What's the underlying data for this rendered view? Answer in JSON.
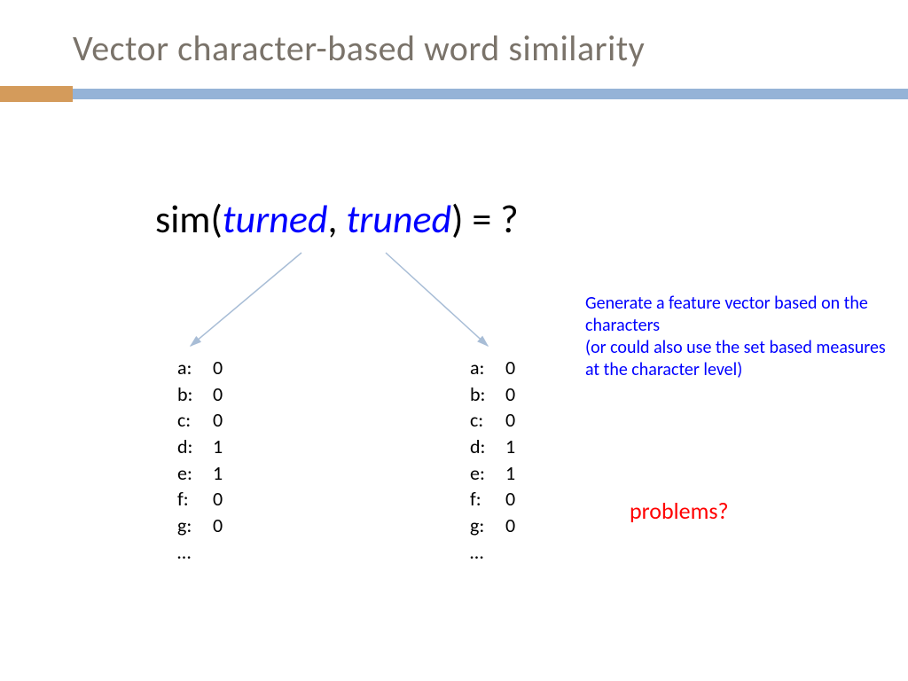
{
  "title": "Vector character-based word similarity",
  "equation": {
    "prefix": "sim(",
    "word1": "turned",
    "sep": ", ",
    "word2": "truned",
    "suffix": ") = ?"
  },
  "vector_left": [
    {
      "k": "a:",
      "v": "0"
    },
    {
      "k": "b:",
      "v": "0"
    },
    {
      "k": "c:",
      "v": "0"
    },
    {
      "k": "d:",
      "v": "1"
    },
    {
      "k": "e:",
      "v": "1"
    },
    {
      "k": "f:",
      "v": "0"
    },
    {
      "k": "g:",
      "v": "0"
    },
    {
      "k": "…",
      "v": ""
    }
  ],
  "vector_right": [
    {
      "k": "a:",
      "v": "0"
    },
    {
      "k": "b:",
      "v": "0"
    },
    {
      "k": "c:",
      "v": "0"
    },
    {
      "k": "d:",
      "v": "1"
    },
    {
      "k": "e:",
      "v": "1"
    },
    {
      "k": "f:",
      "v": "0"
    },
    {
      "k": "g:",
      "v": "0"
    },
    {
      "k": "…",
      "v": ""
    }
  ],
  "annotation": "Generate a feature vector based on the characters\n(or could also use the set based measures at the character level)",
  "problems": "problems?"
}
